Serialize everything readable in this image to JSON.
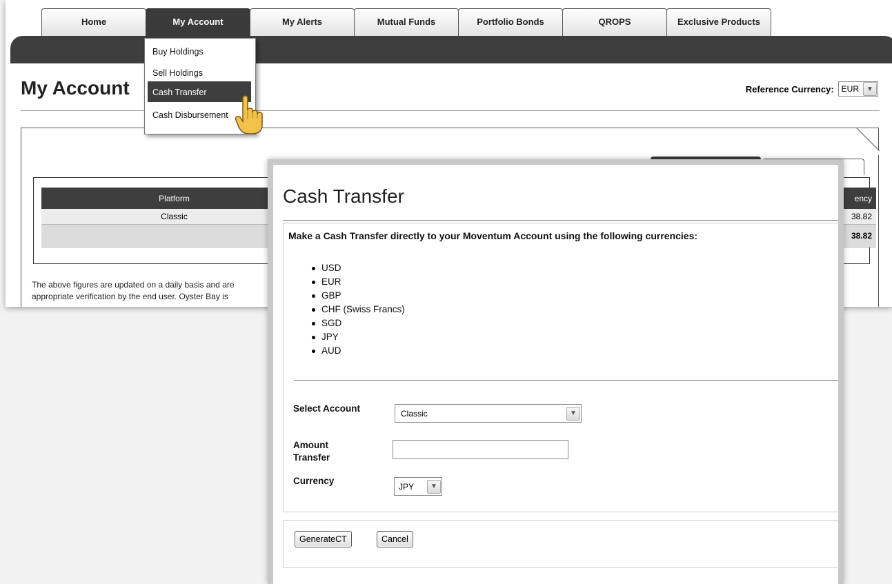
{
  "nav": {
    "tabs": [
      {
        "label": "Home"
      },
      {
        "label": "My Account"
      },
      {
        "label": "My Alerts"
      },
      {
        "label": "Mutual Funds"
      },
      {
        "label": "Portfolio Bonds"
      },
      {
        "label": "QROPS"
      },
      {
        "label": "Exclusive Products"
      }
    ],
    "active_tab": "My Account"
  },
  "menu": {
    "items": [
      {
        "label": "Buy Holdings"
      },
      {
        "label": "Sell Holdings"
      },
      {
        "label": "Cash Transfer"
      },
      {
        "label": "Cash Disbursement"
      }
    ],
    "highlighted": "Cash Transfer"
  },
  "page": {
    "title": "My Account",
    "reference_currency_label": "Reference Currency:",
    "reference_currency_value": "EUR"
  },
  "summary_table": {
    "header_platform": "Platform",
    "header_currency_partial": "ency",
    "row_platform": "Classic",
    "row_value_partial": "38.82",
    "total_value_partial": "38.82"
  },
  "footnote": {
    "line1": "The above figures are updated on a daily basis and are",
    "line2": "appropriate verification by the end user. Oyster Bay is"
  },
  "modal": {
    "title": "Cash Transfer",
    "intro": "Make a Cash Transfer directly to your Moventum Account using the following currencies:",
    "currencies": [
      "USD",
      "EUR",
      "GBP",
      "CHF (Swiss Francs)",
      "SGD",
      "JPY",
      "AUD"
    ],
    "form": {
      "select_account_label": "Select Account",
      "select_account_value": "Classic",
      "amount_label_line1": "Amount",
      "amount_label_line2": "Transfer",
      "amount_value": "",
      "currency_label": "Currency",
      "currency_value": "JPY"
    },
    "buttons": {
      "generate": "GenerateCT",
      "cancel": "Cancel"
    }
  }
}
